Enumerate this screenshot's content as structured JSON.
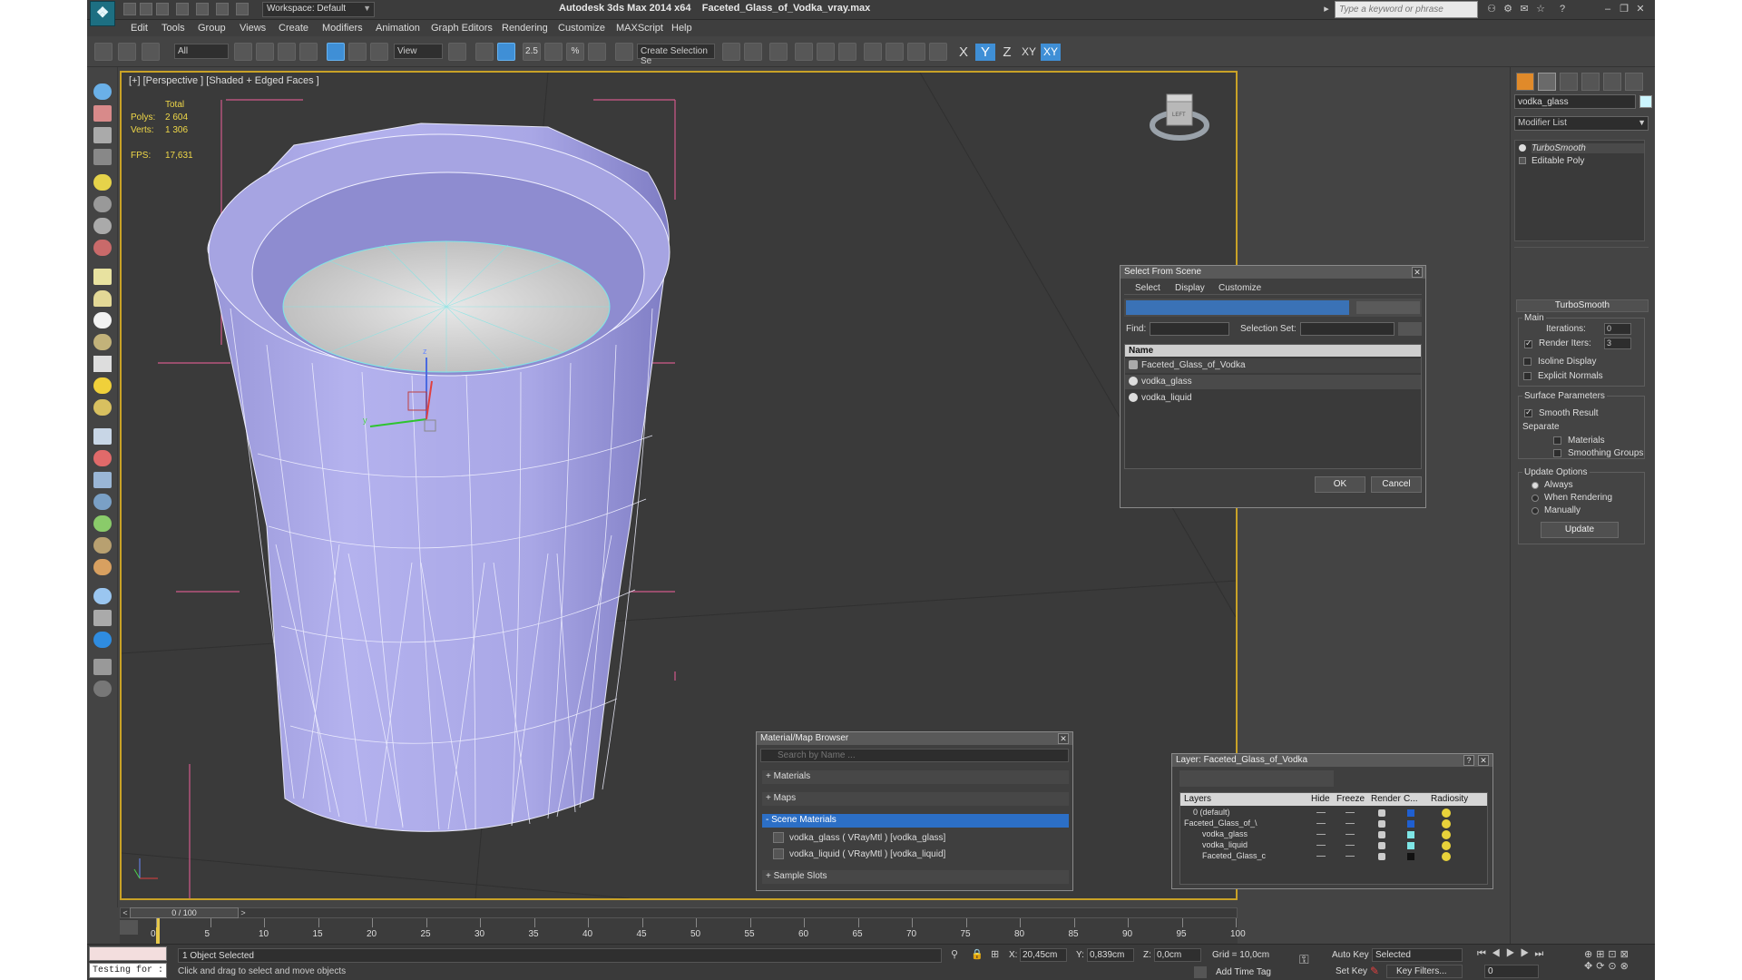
{
  "window": {
    "app_title": "Autodesk 3ds Max  2014 x64",
    "file_name": "Faceted_Glass_of_Vodka_vray.max",
    "workspace": "Workspace: Default",
    "search_placeholder": "Type a keyword or phrase"
  },
  "menus": [
    "Edit",
    "Tools",
    "Group",
    "Views",
    "Create",
    "Modifiers",
    "Animation",
    "Graph Editors",
    "Rendering",
    "Customize",
    "MAXScript",
    "Help"
  ],
  "toolbar": {
    "selection_filter": "All",
    "ref_coord": "View",
    "snap_label": "2.5",
    "angle_snap": "%",
    "named_selection": "Create Selection Se",
    "axes": [
      "X",
      "Y",
      "Z",
      "XY",
      "XY"
    ],
    "active_axis_index": 1
  },
  "viewport": {
    "label": "[+] [Perspective ] [Shaded + Edged Faces ]",
    "stats_total": "Total",
    "polys_label": "Polys:",
    "polys_value": "2 604",
    "verts_label": "Verts:",
    "verts_value": "1 306",
    "fps_label": "FPS:",
    "fps_value": "17,631",
    "gizmo_x": "x",
    "gizmo_y": "y",
    "gizmo_z": "z",
    "viewcube_label": "LEFT"
  },
  "select_from_scene": {
    "title": "Select From Scene",
    "tabs": [
      "Select",
      "Display",
      "Customize"
    ],
    "find_label": "Find:",
    "selset_label": "Selection Set:",
    "column_name": "Name",
    "items": [
      "Faceted_Glass_of_Vodka",
      "vodka_glass",
      "vodka_liquid"
    ],
    "ok": "OK",
    "cancel": "Cancel"
  },
  "material_browser": {
    "title": "Material/Map Browser",
    "search_placeholder": "Search by Name ...",
    "materials": "+ Materials",
    "maps": "+ Maps",
    "scene_materials": "- Scene Materials",
    "items": [
      "vodka_glass  ( VRayMtl ) [vodka_glass]",
      "vodka_liquid  ( VRayMtl ) [vodka_liquid]"
    ],
    "sample_slots": "+ Sample Slots"
  },
  "layer_dialog": {
    "title": "Layer: Faceted_Glass_of_Vodka",
    "help": "?",
    "columns": [
      "Layers",
      "Hide",
      "Freeze",
      "Render",
      "C...",
      "Radiosity"
    ],
    "rows": [
      {
        "name": "0 (default)",
        "color": "#1f5fd0"
      },
      {
        "name": "Faceted_Glass_of_\\",
        "color": "#1f5fd0"
      },
      {
        "name": "vodka_glass",
        "color": "#7ee6e6"
      },
      {
        "name": "vodka_liquid",
        "color": "#7ee6e6"
      },
      {
        "name": "Faceted_Glass_c",
        "color": "#111111"
      }
    ]
  },
  "command_panel": {
    "object_name": "vodka_glass",
    "object_color": "#ccf6ff",
    "modifier_list": "Modifier List",
    "stack": [
      "TurboSmooth",
      "Editable Poly"
    ],
    "rollout_title": "TurboSmooth",
    "main_group": "Main",
    "iterations_label": "Iterations:",
    "iterations_value": "0",
    "render_iters_label": "Render Iters:",
    "render_iters_value": "3",
    "isoline": "Isoline Display",
    "explicit_normals": "Explicit Normals",
    "surface_params": "Surface Parameters",
    "smooth_result": "Smooth Result",
    "separate": "Separate",
    "materials": "Materials",
    "smoothing_groups": "Smoothing Groups",
    "update_options": "Update Options",
    "always": "Always",
    "when_rendering": "When Rendering",
    "manually": "Manually",
    "update_button": "Update"
  },
  "timeline": {
    "frame_counter": "0 / 100",
    "ticks": [
      "0",
      "5",
      "10",
      "15",
      "20",
      "25",
      "30",
      "35",
      "40",
      "45",
      "50",
      "55",
      "60",
      "65",
      "70",
      "75",
      "80",
      "85",
      "90",
      "95",
      "100"
    ]
  },
  "status": {
    "maxscript": "Testing for :",
    "selected": "1 Object Selected",
    "prompt": "Click and drag to select and move objects",
    "x_label": "X:",
    "x_value": "20,45cm",
    "y_label": "Y:",
    "y_value": "0,839cm",
    "z_label": "Z:",
    "z_value": "0,0cm",
    "grid": "Grid = 10,0cm",
    "add_time_tag": "Add Time Tag",
    "auto_key": "Auto Key",
    "set_key": "Set Key",
    "key_mode": "Selected",
    "key_filters": "Key Filters...",
    "frame_value": "0"
  }
}
